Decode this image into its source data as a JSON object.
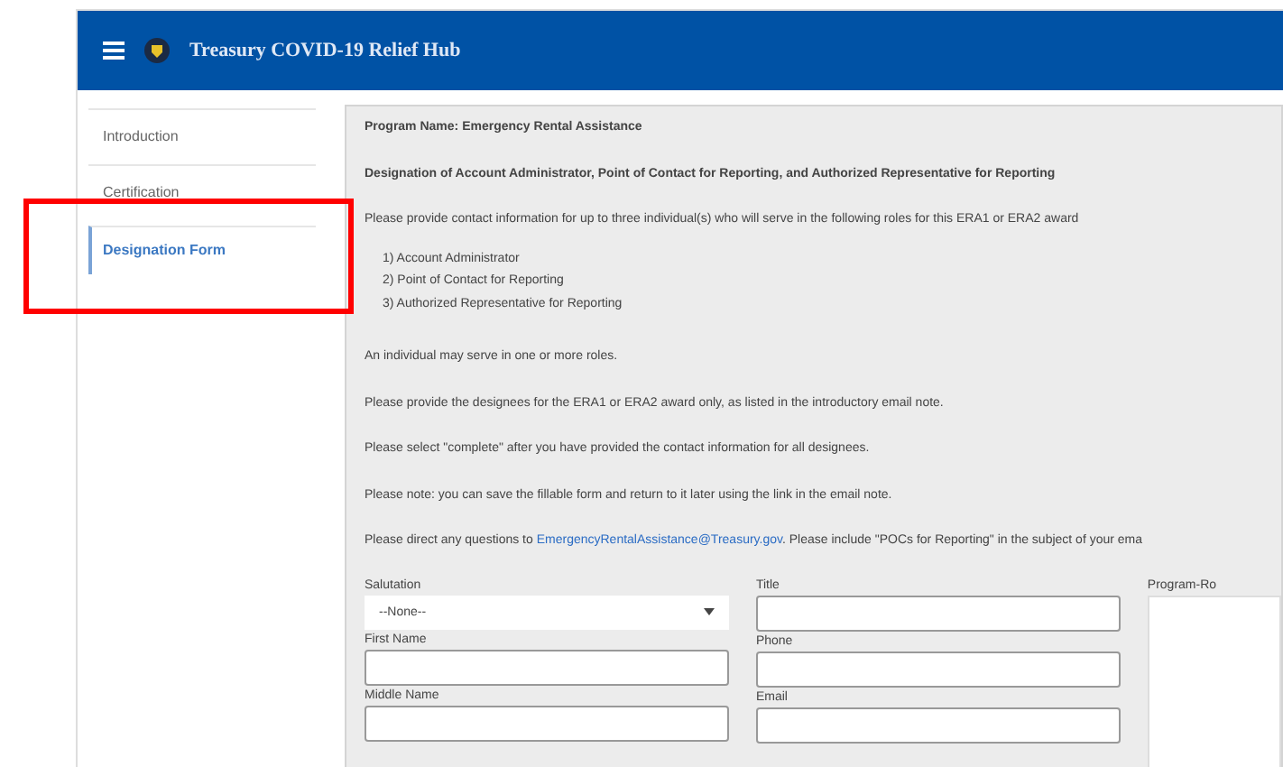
{
  "header": {
    "title": "Treasury COVID-19 Relief Hub"
  },
  "sidebar": {
    "items": [
      {
        "label": "Introduction",
        "selected": false
      },
      {
        "label": "Certification",
        "selected": false
      },
      {
        "label": "Designation Form",
        "selected": true
      }
    ]
  },
  "annotation": {
    "kind": "highlight"
  },
  "content": {
    "program_name": "Program Name: Emergency Rental Assistance",
    "heading": "Designation of Account Administrator, Point of Contact for Reporting, and Authorized Representative for Reporting",
    "intro": "Please provide contact information for up to three individual(s) who will serve in the following roles for this ERA1 or ERA2 award",
    "roles": [
      "1) Account Administrator",
      "2) Point of Contact for Reporting",
      "3) Authorized Representative for Reporting"
    ],
    "paragraphs": [
      "An individual may serve in one or more roles.",
      "Please provide the designees for the ERA1 or ERA2 award only, as listed in the introductory email note.",
      "Please select \"complete\" after you have provided the contact information for all designees.",
      "Please note: you can save the fillable form and return to it later using the link in the email note."
    ],
    "contact": {
      "before": "Please direct any questions to",
      "link": "EmergencyRentalAssistance@Treasury.gov",
      "after": ". Please include \"POCs for Reporting\" in the subject of your ema"
    }
  },
  "form": {
    "salutation": {
      "label": "Salutation",
      "value": "--None--"
    },
    "fields_left": [
      {
        "label": "First Name"
      },
      {
        "label": "Middle Name"
      }
    ],
    "title": {
      "label": "Title"
    },
    "fields_right": [
      {
        "label": "Phone"
      },
      {
        "label": "Email"
      }
    ],
    "side_label": "Program-Ro"
  }
}
